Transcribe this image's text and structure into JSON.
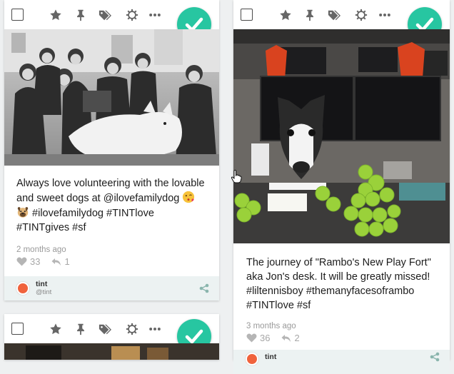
{
  "colors": {
    "accent": "#27c6a1",
    "footer_bg": "#ecf2f2",
    "page_bg": "#eef0f1"
  },
  "toolbar_icons": [
    "select-checkbox",
    "star-icon",
    "pin-icon",
    "tags-icon",
    "gear-icon",
    "more-icon"
  ],
  "posts": [
    {
      "image": "black-and-white group photo of volunteers with a fluffy dog",
      "text_line1": "Always love volunteering with the lovable",
      "text_line2": "and sweet dogs at @ilovefamilydog",
      "text_line3": "#ilovefamilydog #TINTlove",
      "text_line4": "#TINTgives #sf",
      "emoji1": "kissing-face-emoji",
      "emoji2": "dog-face-emoji",
      "time": "2 months ago",
      "likes": "33",
      "reposts": "1",
      "author_name": "tint",
      "author_handle": "@tint"
    },
    {
      "image": "office desk with a dog face cutout and tennis balls",
      "text_line1": "The journey of \"Rambo's New Play Fort\"",
      "text_line2": "aka Jon's desk. It will be greatly missed!",
      "text_line3": "#liltennisboy #themanyfacesoframbo",
      "text_line4": "#TINTlove #sf",
      "time": "3 months ago",
      "likes": "36",
      "reposts": "2",
      "author_name": "tint"
    }
  ]
}
